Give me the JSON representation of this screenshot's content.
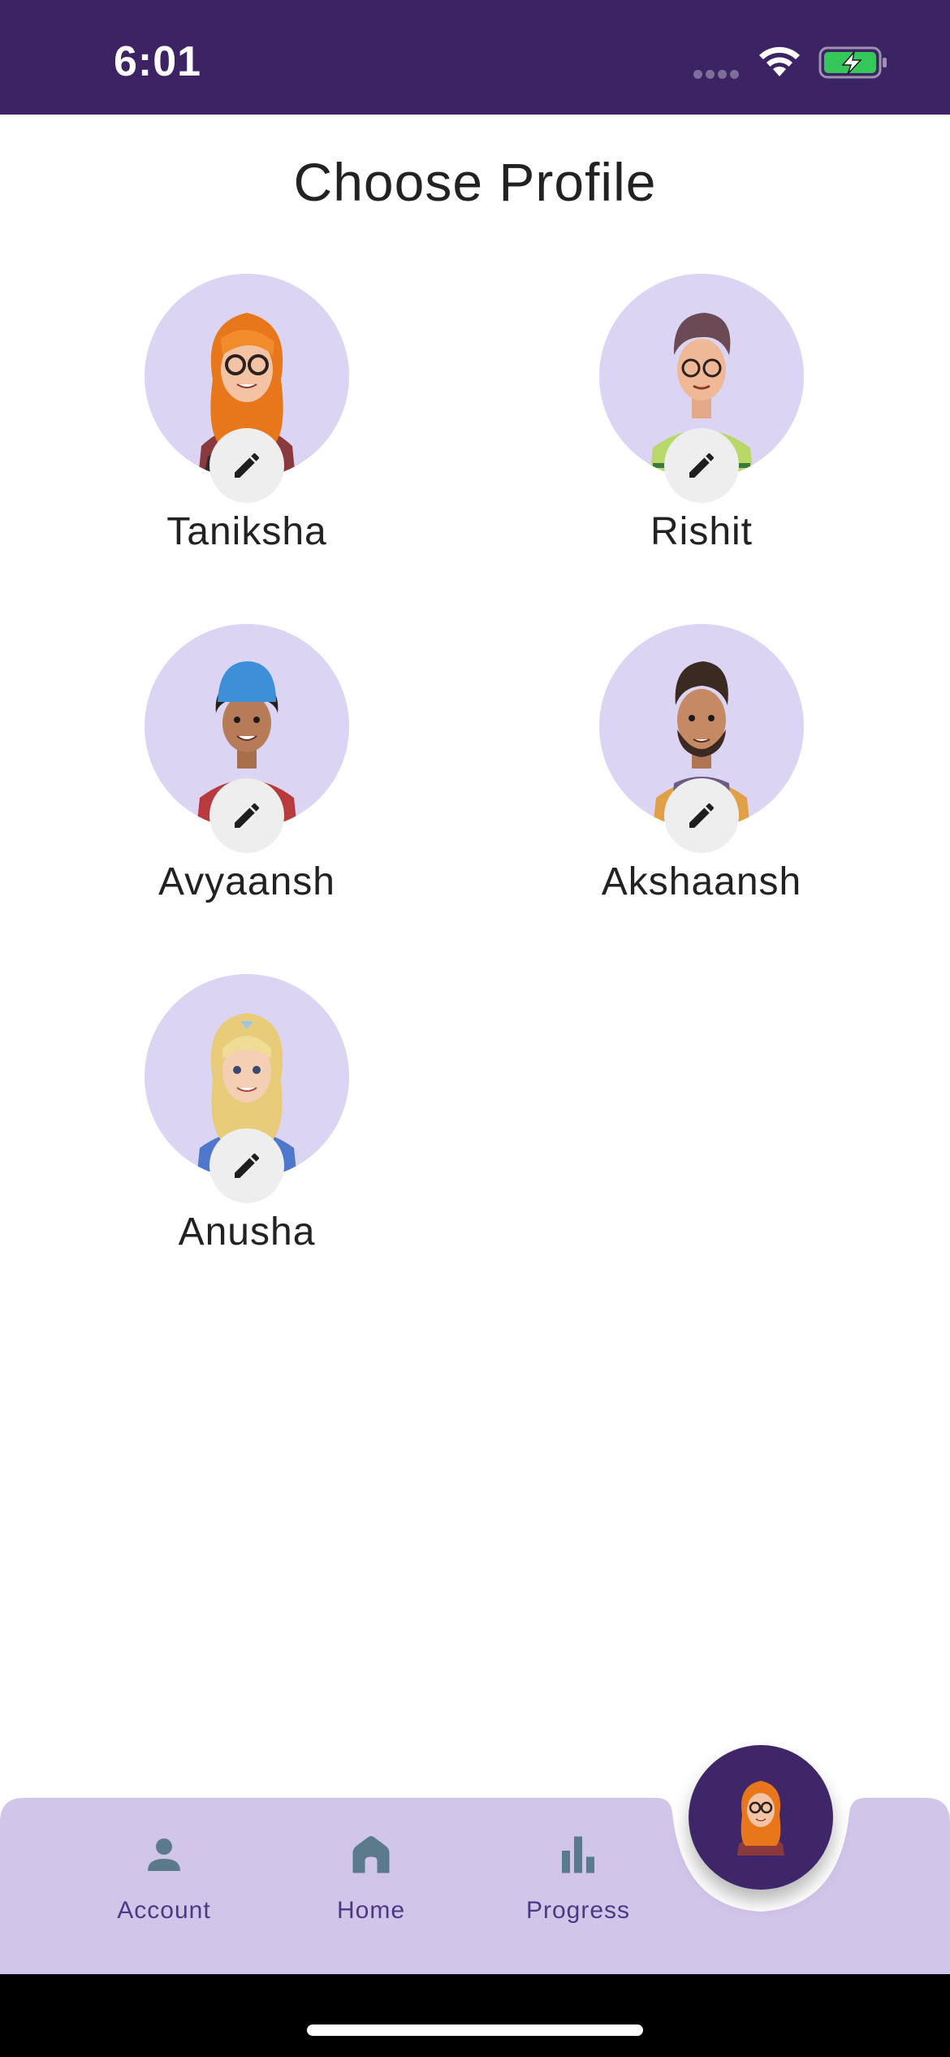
{
  "status_bar": {
    "time": "6:01",
    "icons": [
      "signal-dots-icon",
      "wifi-icon",
      "battery-charging-icon"
    ],
    "background": "#3b2364"
  },
  "page": {
    "title": "Choose Profile"
  },
  "profiles": [
    {
      "name": "Taniksha",
      "avatar": "girl-orange-hair-glasses-avatar",
      "action_icon": "pencil-icon"
    },
    {
      "name": "Rishit",
      "avatar": "boy-glasses-green-shirt-avatar",
      "action_icon": "pencil-icon"
    },
    {
      "name": "Avyaansh",
      "avatar": "boy-blue-cap-red-shirt-avatar",
      "action_icon": "pencil-icon"
    },
    {
      "name": "Akshaansh",
      "avatar": "man-beard-purple-shirt-avatar",
      "action_icon": "pencil-icon"
    },
    {
      "name": "Anusha",
      "avatar": "girl-blonde-blue-shirt-avatar",
      "action_icon": "pencil-icon"
    }
  ],
  "bottom_nav": {
    "items": [
      {
        "label": "Account",
        "icon": "person-icon"
      },
      {
        "label": "Home",
        "icon": "home-icon"
      },
      {
        "label": "Progress",
        "icon": "bar-chart-icon"
      }
    ],
    "fab_avatar": "girl-orange-hair-glasses-avatar"
  },
  "colors": {
    "accent": "#3b2364",
    "avatar_bg": "#dbd5f3",
    "nav_bg": "#d2c5ea",
    "nav_icon": "#5b7a8c",
    "nav_label": "#4a3a86"
  }
}
